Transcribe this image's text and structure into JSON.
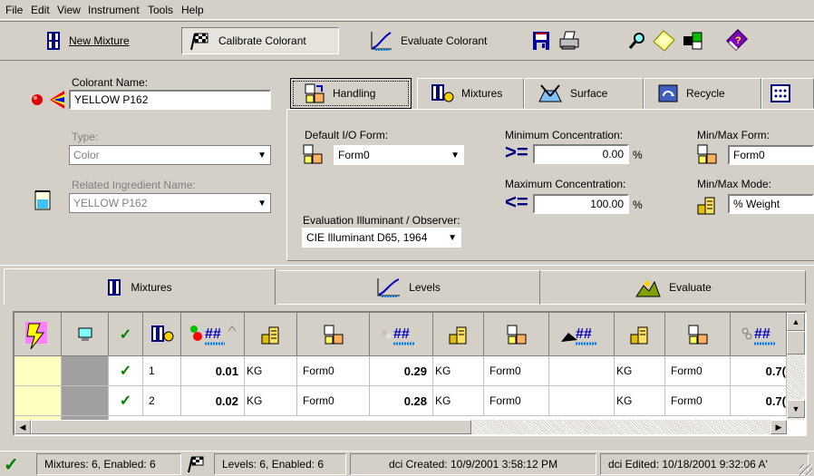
{
  "menu": [
    "File",
    "Edit",
    "View",
    "Instrument",
    "Tools",
    "Help"
  ],
  "toolbar": {
    "new_mixture": "New Mixture",
    "calibrate": "Calibrate Colorant",
    "evaluate": "Evaluate Colorant"
  },
  "colorant": {
    "name_label": "Colorant Name:",
    "name_value": "YELLOW P162",
    "type_label": "Type:",
    "type_value": "Color",
    "related_label": "Related Ingredient Name:",
    "related_value": "YELLOW P162"
  },
  "tabs": [
    "Handling",
    "Mixtures",
    "Surface",
    "Recycle"
  ],
  "handling": {
    "io_form_label": "Default I/O Form:",
    "io_form_value": "Form0",
    "min_conc_label": "Minimum Concentration:",
    "min_conc_value": "0.00",
    "min_conc_unit": "%",
    "max_conc_label": "Maximum Concentration:",
    "max_conc_value": "100.00",
    "max_conc_unit": "%",
    "minmax_form_label": "Min/Max Form:",
    "minmax_form_value": "Form0",
    "minmax_mode_label": "Min/Max Mode:",
    "minmax_mode_value": "% Weight",
    "illum_label": "Evaluation Illuminant / Observer:",
    "illum_value": "CIE Illuminant D65, 1964"
  },
  "lower_tabs": [
    "Mixtures",
    "Levels",
    "Evaluate"
  ],
  "grid": {
    "rows": [
      {
        "idx": "1",
        "c1": "0.01",
        "u1": "KG",
        "f1": "Form0",
        "c2": "0.29",
        "u2": "KG",
        "f2": "Form0",
        "c3": "",
        "u3": "KG",
        "f3": "Form0",
        "c4": "0.7("
      },
      {
        "idx": "2",
        "c1": "0.02",
        "u1": "KG",
        "f1": "Form0",
        "c2": "0.28",
        "u2": "KG",
        "f2": "Form0",
        "c3": "",
        "u3": "KG",
        "f3": "Form0",
        "c4": "0.7("
      }
    ]
  },
  "status": {
    "mixtures": "Mixtures: 6, Enabled: 6",
    "levels": "Levels: 6, Enabled: 6",
    "created": "dci Created: 10/9/2001 3:58:12 PM",
    "edited": "dci Edited: 10/18/2001 9:32:06 A'"
  },
  "colors": {
    "accent": "#0000c0",
    "ok": "#008000",
    "cell_yellow": "#ffffc0",
    "cell_gray": "#a0a0a0"
  }
}
